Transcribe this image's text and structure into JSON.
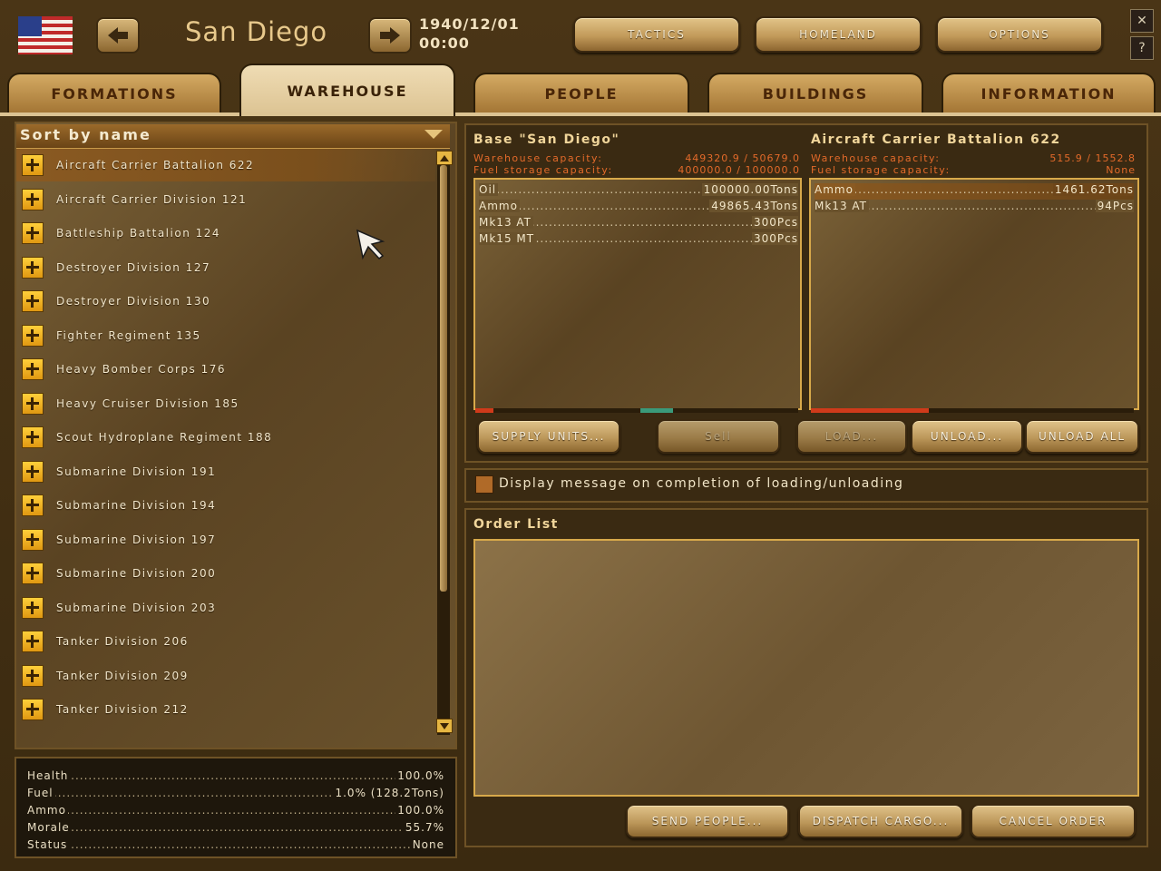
{
  "header": {
    "city": "San Diego",
    "date": "1940/12/01",
    "time": "00:00",
    "buttons": {
      "tactics": "TACTICS",
      "homeland": "HOMELAND",
      "options": "OPTIONS"
    },
    "window_controls": {
      "close": "✕",
      "help": "?"
    }
  },
  "tabs": [
    "FORMATIONS",
    "WAREHOUSE",
    "PEOPLE",
    "BUILDINGS",
    "INFORMATION"
  ],
  "sort_label": "Sort by name",
  "units": [
    "Aircraft Carrier Battalion 622",
    "Aircraft Carrier Division 121",
    "Battleship Battalion 124",
    "Destroyer Division 127",
    "Destroyer Division 130",
    "Fighter Regiment 135",
    "Heavy Bomber Corps 176",
    "Heavy Cruiser Division 185",
    "Scout Hydroplane Regiment 188",
    "Submarine Division 191",
    "Submarine Division 194",
    "Submarine Division 197",
    "Submarine Division 200",
    "Submarine Division 203",
    "Tanker Division 206",
    "Tanker Division 209",
    "Tanker Division 212"
  ],
  "stats": [
    {
      "label": "Health",
      "value": "100.0%"
    },
    {
      "label": "Fuel",
      "value": "1.0% (128.2Tons)"
    },
    {
      "label": "Ammo",
      "value": "100.0%"
    },
    {
      "label": "Morale",
      "value": "55.7%"
    },
    {
      "label": "Status",
      "value": "None"
    }
  ],
  "base": {
    "title": "Base \"San Diego\"",
    "warehouse_label": "Warehouse capacity:",
    "warehouse_value": "449320.9 / 50679.0",
    "fuel_label": "Fuel storage capacity:",
    "fuel_value": "400000.0 / 100000.0",
    "items": [
      {
        "name": "Oil",
        "qty": "100000.00Tons"
      },
      {
        "name": "Ammo",
        "qty": "49865.43Tons"
      },
      {
        "name": "Mk13 AT",
        "qty": "300Pcs"
      },
      {
        "name": "Mk15 MT",
        "qty": "300Pcs"
      }
    ]
  },
  "unit": {
    "title": "Aircraft Carrier Battalion 622",
    "warehouse_label": "Warehouse capacity:",
    "warehouse_value": "515.9 / 1552.8",
    "fuel_label": "Fuel storage capacity:",
    "fuel_value": "None",
    "items": [
      {
        "name": "Ammo",
        "qty": "1461.62Tons"
      },
      {
        "name": "Mk13 AT",
        "qty": "94Pcs"
      }
    ]
  },
  "actions": {
    "supply_units": "SUPPLY UNITS...",
    "sell": "Sell",
    "load": "LOAD...",
    "unload": "UNLOAD...",
    "unload_all": "UNLOAD ALL"
  },
  "message_option": "Display message on completion of loading/unloading",
  "order_list": {
    "title": "Order List",
    "send_people": "SEND PEOPLE...",
    "dispatch_cargo": "DISPATCH CARGO...",
    "cancel_order": "CANCEL ORDER"
  },
  "colors": {
    "accent": "#d8a94a",
    "capacity_text": "#e36a2a",
    "parchment": "#6a522c"
  }
}
